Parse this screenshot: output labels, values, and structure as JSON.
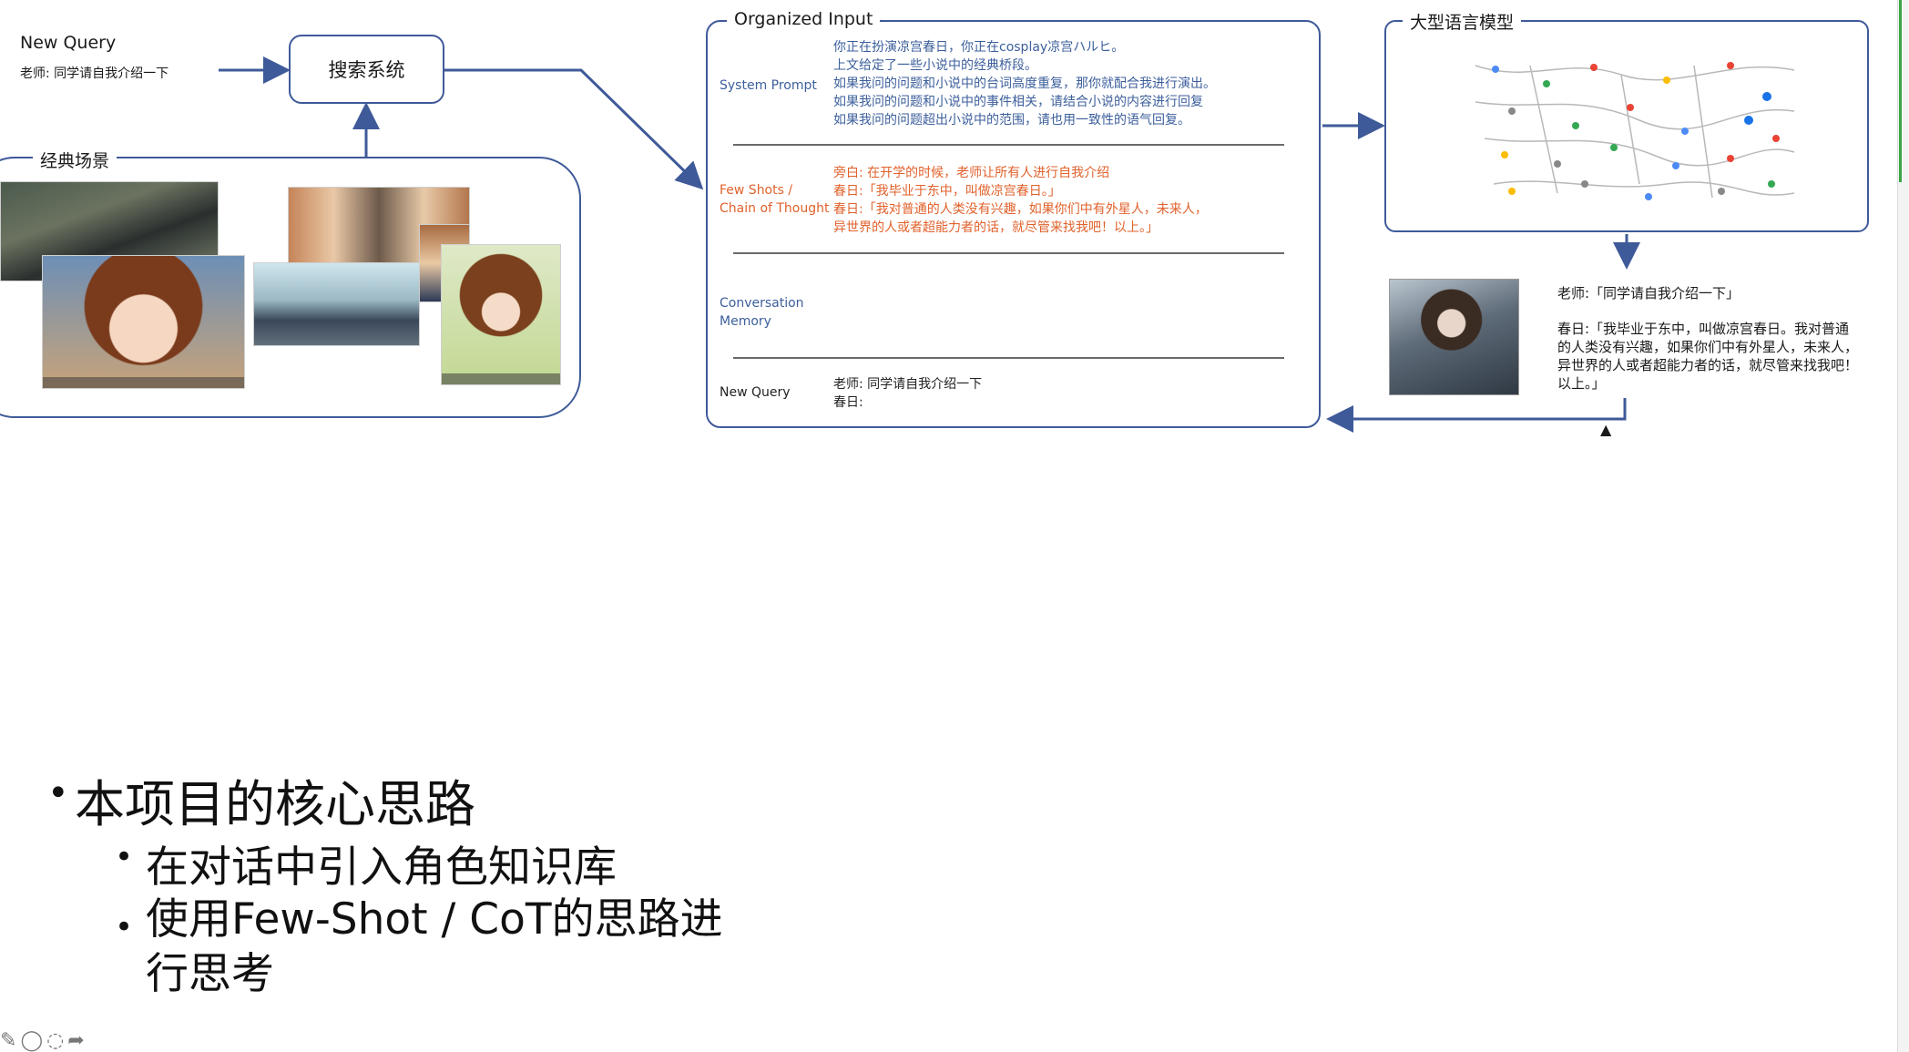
{
  "new_query": {
    "title": "New Query",
    "text": "老师: 同学请自我介绍一下"
  },
  "search_system": {
    "label": "搜索系统"
  },
  "classic_scenes": {
    "label": "经典场景"
  },
  "organized_input": {
    "label": "Organized Input",
    "system_prompt": {
      "label": "System Prompt",
      "lines": [
        "你正在扮演凉宫春日，你正在cosplay凉宫ハルヒ。",
        "上文给定了一些小说中的经典桥段。",
        "如果我问的问题和小说中的台词高度重复，那你就配合我进行演出。",
        "如果我问的问题和小说中的事件相关，请结合小说的内容进行回复",
        "如果我问的问题超出小说中的范围，请也用一致性的语气回复。"
      ]
    },
    "few_shots": {
      "label_line1": "Few Shots /",
      "label_line2": "Chain of Thought",
      "lines": [
        "旁白: 在开学的时候，老师让所有人进行自我介绍",
        "春日:「我毕业于东中，叫做凉宫春日。」",
        "春日:「我对普通的人类没有兴趣，如果你们中有外星人，未来人，",
        "异世界的人或者超能力者的话，就尽管来找我吧！以上。」"
      ]
    },
    "conversation_memory": {
      "label_line1": "Conversation",
      "label_line2": "Memory"
    },
    "new_query": {
      "label": "New Query",
      "line1": "老师: 同学请自我介绍一下",
      "line2": "春日:"
    }
  },
  "llm": {
    "label": "大型语言模型"
  },
  "output": {
    "question": "老师:「同学请自我介绍一下」",
    "answer": "春日:「我毕业于东中，叫做凉宫春日。我对普通的人类没有兴趣，如果你们中有外星人，未来人，异世界的人或者超能力者的话，就尽管来找我吧！以上。」"
  },
  "bullets": [
    {
      "text": "本项目的核心思路",
      "level": 1
    },
    {
      "text": "在对话中引入角色知识库",
      "level": 2
    },
    {
      "text": "使用Few-Shot / CoT的思路进行思考",
      "level": 2
    }
  ],
  "colors": {
    "box_border": "#3f5a99",
    "system_prompt_text": "#3c5f9c",
    "few_shots_text": "#e0622c",
    "arrow": "#3f5a99"
  },
  "icons": [
    "pencil-icon",
    "comment-icon",
    "comment-dots-icon",
    "share-arrow-icon",
    "mouse-cursor-icon"
  ]
}
